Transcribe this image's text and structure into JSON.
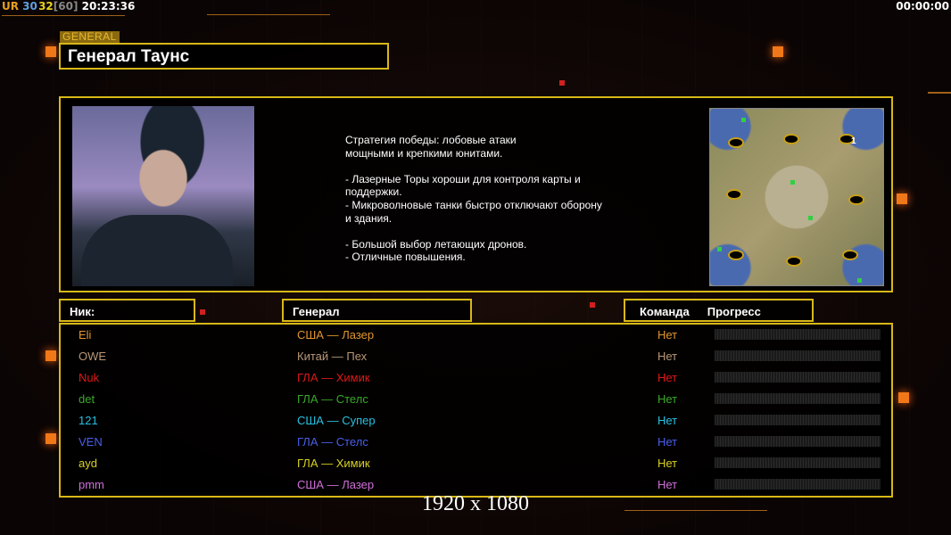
{
  "hud": {
    "ur": "UR",
    "fps": "30",
    "fps2": "32",
    "cap": "[60]",
    "clock": "20:23:36",
    "timer": "00:00:00"
  },
  "general_tag": "GENERAL",
  "general_name": "Генерал Таунс",
  "description": "Стратегия победы: лобовые атаки\nмощными и крепкими юнитами.\n\n- Лазерные Торы хороши для контроля карты и\n поддержки.\n- Микроволновые танки быстро отключают оборону\n и здания.\n\n- Большой выбор летающих дронов.\n- Отличные повышения.",
  "map_marker": "1",
  "headers": {
    "nick": "Ник:",
    "general": "Генерал",
    "team": "Команда",
    "progress": "Прогресс"
  },
  "players": [
    {
      "nick": "Eli",
      "general": "США — Лазер",
      "team": "Нет",
      "progress": 0,
      "color": "#e0962e"
    },
    {
      "nick": "OWE",
      "general": "Китай — Пех",
      "team": "Нет",
      "progress": 0,
      "color": "#b89878"
    },
    {
      "nick": "Nuk",
      "general": "ГЛА — Химик",
      "team": "Нет",
      "progress": 0,
      "color": "#e01818"
    },
    {
      "nick": "det",
      "general": "ГЛА — Стелс",
      "team": "Нет",
      "progress": 0,
      "color": "#3aa82a"
    },
    {
      "nick": "121",
      "general": "США — Супер",
      "team": "Нет",
      "progress": 0,
      "color": "#28c0e0"
    },
    {
      "nick": "VEN",
      "general": "ГЛА — Стелс",
      "team": "Нет",
      "progress": 0,
      "color": "#4a5ee8"
    },
    {
      "nick": "ayd",
      "general": "ГЛА — Химик",
      "team": "Нет",
      "progress": 0,
      "color": "#d8d020"
    },
    {
      "nick": "pmm",
      "general": "США — Лазер",
      "team": "Нет",
      "progress": 0,
      "color": "#d070d8"
    }
  ],
  "resolution": "1920 x 1080"
}
